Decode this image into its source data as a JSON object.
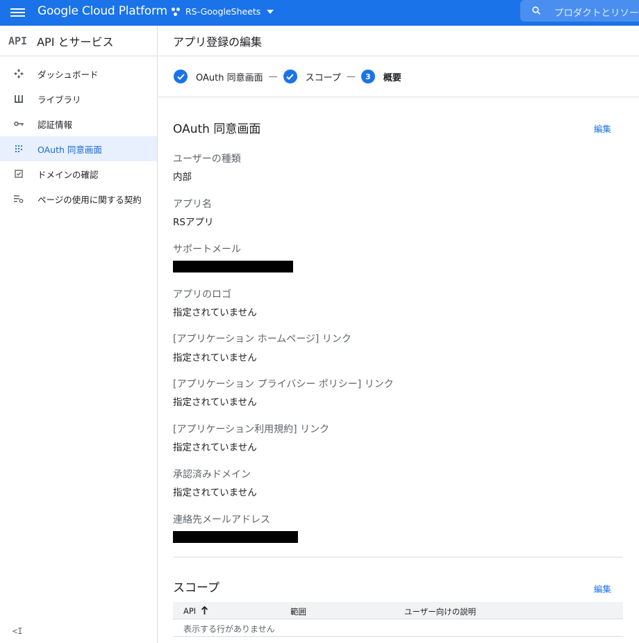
{
  "topbar": {
    "brand": "Google Cloud Platform",
    "project_name": "RS-GoogleSheets",
    "search_placeholder": "プロダクトとリソー"
  },
  "sidebar": {
    "logo": "API",
    "title": "API とサービス",
    "items": [
      {
        "label": "ダッシュボード",
        "icon": "dashboard-icon",
        "active": false
      },
      {
        "label": "ライブラリ",
        "icon": "library-icon",
        "active": false
      },
      {
        "label": "認証情報",
        "icon": "key-icon",
        "active": false
      },
      {
        "label": "OAuth 同意画面",
        "icon": "oauth-consent-icon",
        "active": true
      },
      {
        "label": "ドメインの確認",
        "icon": "domain-check-icon",
        "active": false
      },
      {
        "label": "ページの使用に関する契約",
        "icon": "page-usage-icon",
        "active": false
      }
    ],
    "collapse": "<I"
  },
  "page": {
    "title": "アプリ登録の編集"
  },
  "stepper": {
    "steps": [
      {
        "label": "OAuth 同意画面",
        "state": "done"
      },
      {
        "label": "スコープ",
        "state": "done"
      },
      {
        "label": "概要",
        "state": "current",
        "number": "3"
      }
    ],
    "separator": "—"
  },
  "oauth_section": {
    "title": "OAuth 同意画面",
    "edit": "編集",
    "fields": [
      {
        "label": "ユーザーの種類",
        "value": "内部"
      },
      {
        "label": "アプリ名",
        "value": "RSアプリ"
      },
      {
        "label": "サポートメール",
        "value": "",
        "redacted": true
      },
      {
        "label": "アプリのロゴ",
        "value": "指定されていません"
      },
      {
        "label": "[アプリケーション ホームページ] リンク",
        "value": "指定されていません"
      },
      {
        "label": "[アプリケーション プライバシー ポリシー] リンク",
        "value": "指定されていません"
      },
      {
        "label": "[アプリケーション利用規約] リンク",
        "value": "指定されていません"
      },
      {
        "label": "承認済みドメイン",
        "value": "指定されていません"
      },
      {
        "label": "連絡先メールアドレス",
        "value": "",
        "redacted": true
      }
    ]
  },
  "scope_section": {
    "title": "スコープ",
    "edit": "編集",
    "columns": [
      "API",
      "範囲",
      "ユーザー向けの説明"
    ],
    "sort_icon": "arrow-up-icon",
    "empty_text": "表示する行がありません"
  },
  "colors": {
    "primary": "#1a73e8",
    "active_bg": "#e8f0fe",
    "text": "#202124",
    "muted": "#5f6368",
    "border": "#dadce0"
  }
}
